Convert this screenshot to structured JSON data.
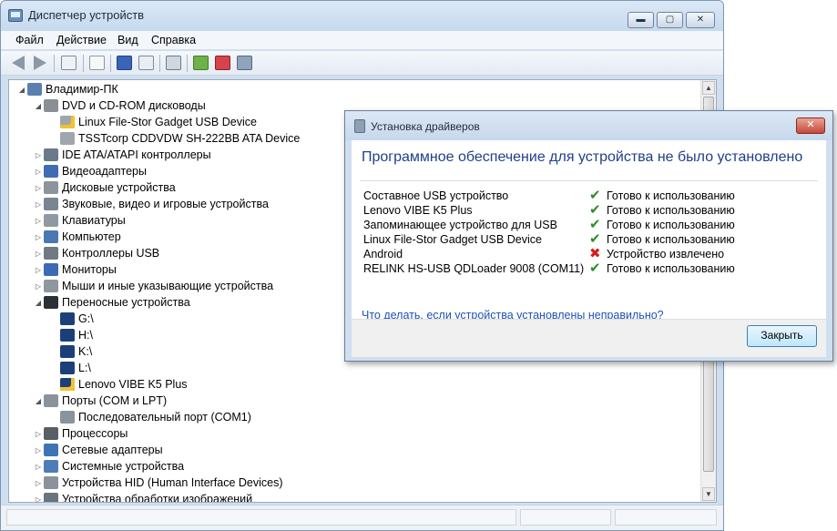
{
  "window": {
    "title": "Диспетчер устройств",
    "controls": {
      "minimize": "▬",
      "maximize": "▢",
      "close": "✕"
    }
  },
  "menu": [
    "Файл",
    "Действие",
    "Вид",
    "Справка"
  ],
  "toolbar": {
    "icons": [
      "back-icon",
      "forward-icon",
      "show-hide-tree-icon",
      "properties-icon",
      "help-icon",
      "show-hidden-icon",
      "scan-hardware-icon",
      "update-driver-icon",
      "uninstall-icon",
      "disable-icon"
    ]
  },
  "tree": [
    {
      "label": "Владимир-ПК",
      "expand": "◢",
      "icon": "computer-icon",
      "color": "#5b7fb0"
    },
    {
      "label": "DVD и CD-ROM дисководы",
      "expand": "◢",
      "icon": "dvd-drive-icon",
      "color": "#8a8f96"
    },
    {
      "label": "Linux File-Stor Gadget USB Device",
      "expand": "",
      "icon": "drive-warning-icon",
      "color": "#a0a6ad"
    },
    {
      "label": "TSSTcorp CDDVDW SH-222BB ATA Device",
      "expand": "",
      "icon": "dvd-drive-icon",
      "color": "#a0a6ad"
    },
    {
      "label": "IDE ATA/ATAPI контроллеры",
      "expand": "▷",
      "icon": "ide-controller-icon",
      "color": "#6a7a8a"
    },
    {
      "label": "Видеоадаптеры",
      "expand": "▷",
      "icon": "display-adapter-icon",
      "color": "#3e6db3"
    },
    {
      "label": "Дисковые устройства",
      "expand": "▷",
      "icon": "disk-drive-icon",
      "color": "#8d949b"
    },
    {
      "label": "Звуковые, видео и игровые устройства",
      "expand": "▷",
      "icon": "speaker-icon",
      "color": "#7a8592"
    },
    {
      "label": "Клавиатуры",
      "expand": "▷",
      "icon": "keyboard-icon",
      "color": "#9099a3"
    },
    {
      "label": "Компьютер",
      "expand": "▷",
      "icon": "computer-icon",
      "color": "#4b77b3"
    },
    {
      "label": "Контроллеры USB",
      "expand": "▷",
      "icon": "usb-icon",
      "color": "#707a85"
    },
    {
      "label": "Мониторы",
      "expand": "▷",
      "icon": "monitor-icon",
      "color": "#3c6ab5"
    },
    {
      "label": "Мыши и иные указывающие устройства",
      "expand": "▷",
      "icon": "mouse-icon",
      "color": "#8e97a0"
    },
    {
      "label": "Переносные устройства",
      "expand": "◢",
      "icon": "portable-device-icon",
      "color": "#2b2f36"
    },
    {
      "label": "G:\\",
      "expand": "",
      "icon": "portable-drive-icon",
      "color": "#1c3f7a"
    },
    {
      "label": "H:\\",
      "expand": "",
      "icon": "portable-drive-icon",
      "color": "#1c3f7a"
    },
    {
      "label": "K:\\",
      "expand": "",
      "icon": "portable-drive-icon",
      "color": "#1c3f7a"
    },
    {
      "label": "L:\\",
      "expand": "",
      "icon": "portable-drive-icon",
      "color": "#1c3f7a"
    },
    {
      "label": "Lenovo VIBE K5 Plus",
      "expand": "",
      "icon": "phone-warning-icon",
      "color": "#1c3f7a"
    },
    {
      "label": "Порты (COM и LPT)",
      "expand": "◢",
      "icon": "port-icon",
      "color": "#8a929b"
    },
    {
      "label": "Последовательный порт (COM1)",
      "expand": "",
      "icon": "port-icon",
      "color": "#8a929b"
    },
    {
      "label": "Процессоры",
      "expand": "▷",
      "icon": "processor-icon",
      "color": "#5a5f66"
    },
    {
      "label": "Сетевые адаптеры",
      "expand": "▷",
      "icon": "network-adapter-icon",
      "color": "#3f73b8"
    },
    {
      "label": "Системные устройства",
      "expand": "▷",
      "icon": "system-device-icon",
      "color": "#4d7cb8"
    },
    {
      "label": "Устройства HID (Human Interface Devices)",
      "expand": "▷",
      "icon": "hid-icon",
      "color": "#8a939c"
    },
    {
      "label": "Устройства обработки изображений",
      "expand": "▷",
      "icon": "imaging-device-icon",
      "color": "#6a737c"
    }
  ],
  "dialog": {
    "title": "Установка драйверов",
    "close": "✕",
    "heading": "Программное обеспечение для устройства не было установлено",
    "devices": [
      {
        "name": "Составное USB устройство",
        "status": "Готово к использованию",
        "icon": "✔",
        "state": "ok"
      },
      {
        "name": "Lenovo VIBE K5 Plus",
        "status": "Готово к использованию",
        "icon": "✔",
        "state": "ok"
      },
      {
        "name": "Запоминающее устройство для USB",
        "status": "Готово к использованию",
        "icon": "✔",
        "state": "ok"
      },
      {
        "name": "Linux File-Stor Gadget USB Device",
        "status": "Готово к использованию",
        "icon": "✔",
        "state": "ok"
      },
      {
        "name": "Android",
        "status": "Устройство извлечено",
        "icon": "✖",
        "state": "err"
      },
      {
        "name": "RELINK HS-USB QDLoader 9008 (COM11)",
        "status": "Готово к использованию",
        "icon": "✔",
        "state": "ok"
      }
    ],
    "link": "Что делать, если устройства установлены неправильно?",
    "button": "Закрыть"
  },
  "colors": {
    "ok": "#2f8c2a",
    "error": "#d11f1f",
    "heading": "#1f3f8a",
    "link": "#1d52b8"
  }
}
